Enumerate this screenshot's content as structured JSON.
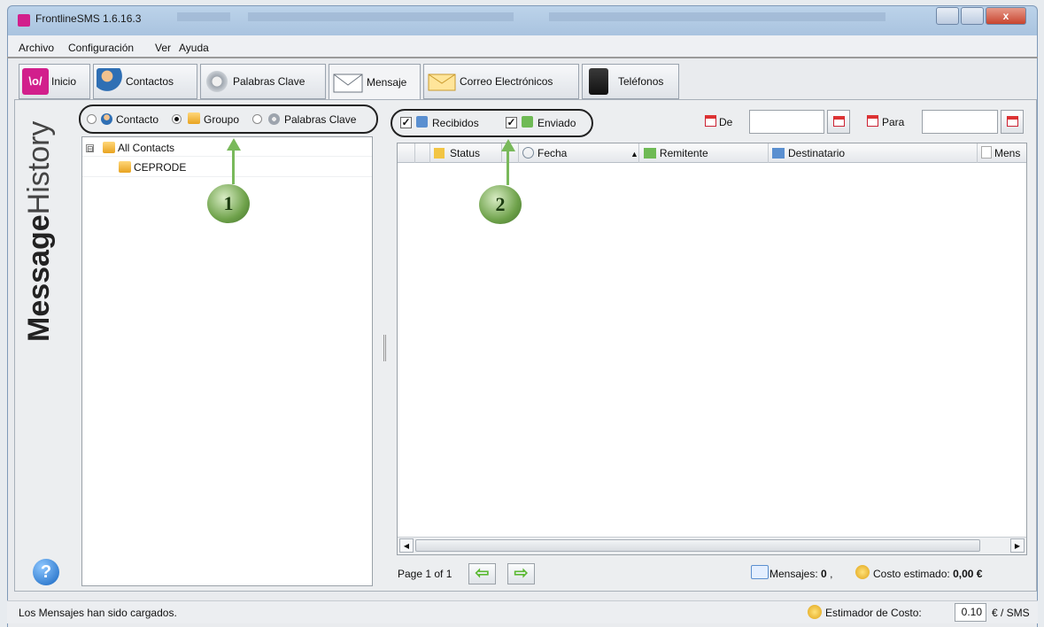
{
  "window": {
    "title": "FrontlineSMS 1.6.16.3",
    "close_glyph": "x"
  },
  "menu": [
    "Archivo",
    "Configuración",
    "Ver",
    "Ayuda"
  ],
  "tabs": [
    {
      "label": "Inicio",
      "icon": "frontline-logo-icon"
    },
    {
      "label": "Contactos",
      "icon": "contacts-icon"
    },
    {
      "label": "Palabras Clave",
      "icon": "gear-icon"
    },
    {
      "label": "Mensaje",
      "icon": "envelope-icon",
      "active": true
    },
    {
      "label": "Correo Electrónicos",
      "icon": "email-icon"
    },
    {
      "label": "Teléfonos",
      "icon": "phone-icon"
    }
  ],
  "sidebar": {
    "vertical_title_bold": "Message",
    "vertical_title_light": "History",
    "help_glyph": "?"
  },
  "filter": {
    "options": [
      {
        "label": "Contacto",
        "selected": false
      },
      {
        "label": "Groupo",
        "selected": true
      },
      {
        "label": "Palabras Clave",
        "selected": false
      }
    ]
  },
  "tree": {
    "expander": "⊟",
    "root": "All Contacts",
    "children": [
      "CEPRODE"
    ]
  },
  "annotations": [
    "1",
    "2"
  ],
  "message_filter": {
    "received_label": "Recibidos",
    "received_checked": true,
    "sent_label": "Enviado",
    "sent_checked": true,
    "check_glyph": "✓"
  },
  "date_filter": {
    "from_label": "De",
    "from_value": "",
    "to_label": "Para",
    "to_value": ""
  },
  "table": {
    "columns": [
      "Status",
      "Fecha",
      "Remitente",
      "Destinatario",
      "Mens"
    ],
    "sort_glyph": "▲",
    "rows": []
  },
  "pagination": {
    "label": "Page 1 of 1",
    "prev_glyph": "⇦",
    "next_glyph": "⇨"
  },
  "summary": {
    "messages_label": "Mensajes:",
    "messages_count": "0",
    "separator": ",",
    "cost_label": "Costo estimado:",
    "cost_value": "0,00 €"
  },
  "status": {
    "message": "Los Mensajes han sido cargados.",
    "estimator_label": "Estimador de Costo:",
    "cost_per_sms": "0.10",
    "unit": "€ / SMS"
  },
  "colors": {
    "accent": "#d21f8c",
    "arrow": "#79b95b"
  }
}
